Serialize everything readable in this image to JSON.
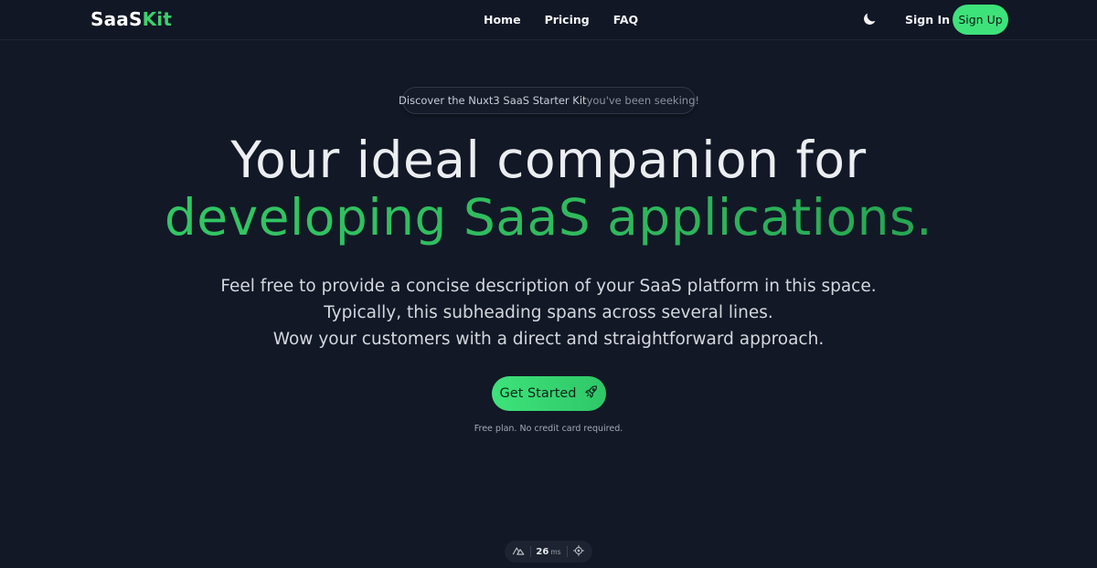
{
  "header": {
    "logo_part1": "SaaS",
    "logo_part2": "Kit",
    "nav": [
      {
        "label": "Home"
      },
      {
        "label": "Pricing"
      },
      {
        "label": "FAQ"
      }
    ],
    "theme_toggle_icon": "moon-icon",
    "signin_label": "Sign In",
    "signup_label": "Sign Up"
  },
  "hero": {
    "pill_text_main": "Discover the Nuxt3 SaaS Starter Kit",
    "pill_text_muted": " you've been seeking!",
    "headline_line1": "Your ideal companion for",
    "headline_line2": "developing SaaS applications.",
    "subheading_lines": [
      "Feel free to provide a concise description of your SaaS platform in this space.",
      "Typically, this subheading spans across several lines.",
      "Wow your customers with a direct and straightforward approach."
    ],
    "cta_label": "Get Started",
    "cta_icon": "rocket-icon",
    "note": "Free plan. No credit card required."
  },
  "devtools": {
    "render_time": "26",
    "render_unit": "ms",
    "left_icon": "nuxt-logo-icon",
    "right_icon": "crosshair-icon"
  },
  "colors": {
    "background": "#121826",
    "accent": "#3ee27a",
    "headline_green": "#2fbf5e"
  }
}
